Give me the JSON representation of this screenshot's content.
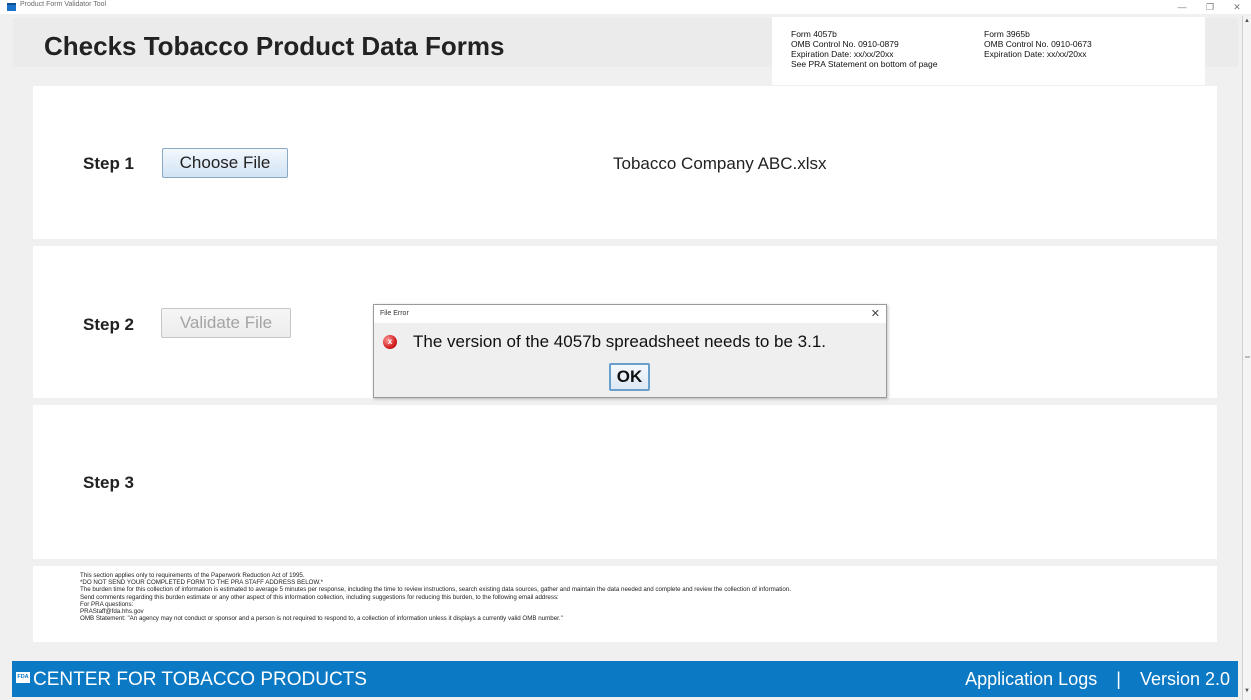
{
  "window": {
    "title": "Product Form Validator Tool",
    "controls": {
      "minimize": "—",
      "restore": "❐",
      "close": "✕"
    }
  },
  "header": {
    "title": "Checks Tobacco Product Data Forms",
    "form_4057b": {
      "form": "Form 4057b",
      "omb": "OMB Control No. 0910-0879",
      "expiration": "Expiration Date: xx/xx/20xx",
      "see_pra": "See PRA Statement on bottom of page"
    },
    "form_3965b": {
      "form": "Form 3965b",
      "omb": "OMB Control No. 0910-0673",
      "expiration": "Expiration Date: xx/xx/20xx"
    }
  },
  "step1": {
    "label": "Step 1",
    "button": "Choose File",
    "file_name": "Tobacco Company ABC.xlsx"
  },
  "step2": {
    "label": "Step 2",
    "button": "Validate File"
  },
  "step3": {
    "label": "Step 3"
  },
  "pra": {
    "lines": [
      "This section applies only to requirements of the Paperwork Reduction Act of 1995.",
      "*DO NOT SEND YOUR COMPLETED FORM TO THE PRA STAFF ADDRESS BELOW.*",
      "The burden time for this collection of information is estimated to average 5 minutes per response, including the time to review instructions, search existing data sources, gather and maintain the data needed and complete and review the collection of information.",
      "Send comments regarding this burden estimate or any other aspect of this information collection, including suggestions for reducing this burden, to the following email address:",
      "For PRA questions:",
      "PRAStaff@fda.hhs.gov",
      "OMB Statement: \"An agency may not conduct or sponsor and a person is not required to respond to, a collection of information unless it displays a currently valid OMB number.\""
    ]
  },
  "footer": {
    "logo": "FDA",
    "center_name": "CENTER FOR TOBACCO PRODUCTS",
    "logs_link": "Application Logs",
    "separator": "|",
    "version": "Version 2.0"
  },
  "dialog": {
    "title": "File Error",
    "close": "✕",
    "icon": "error-icon",
    "message": "The version of the 4057b spreadsheet needs to be 3.1.",
    "ok": "OK"
  },
  "colors": {
    "footer_bg": "#0b79c4",
    "background": "#f0f0f0",
    "error_red": "#d41f1f"
  }
}
